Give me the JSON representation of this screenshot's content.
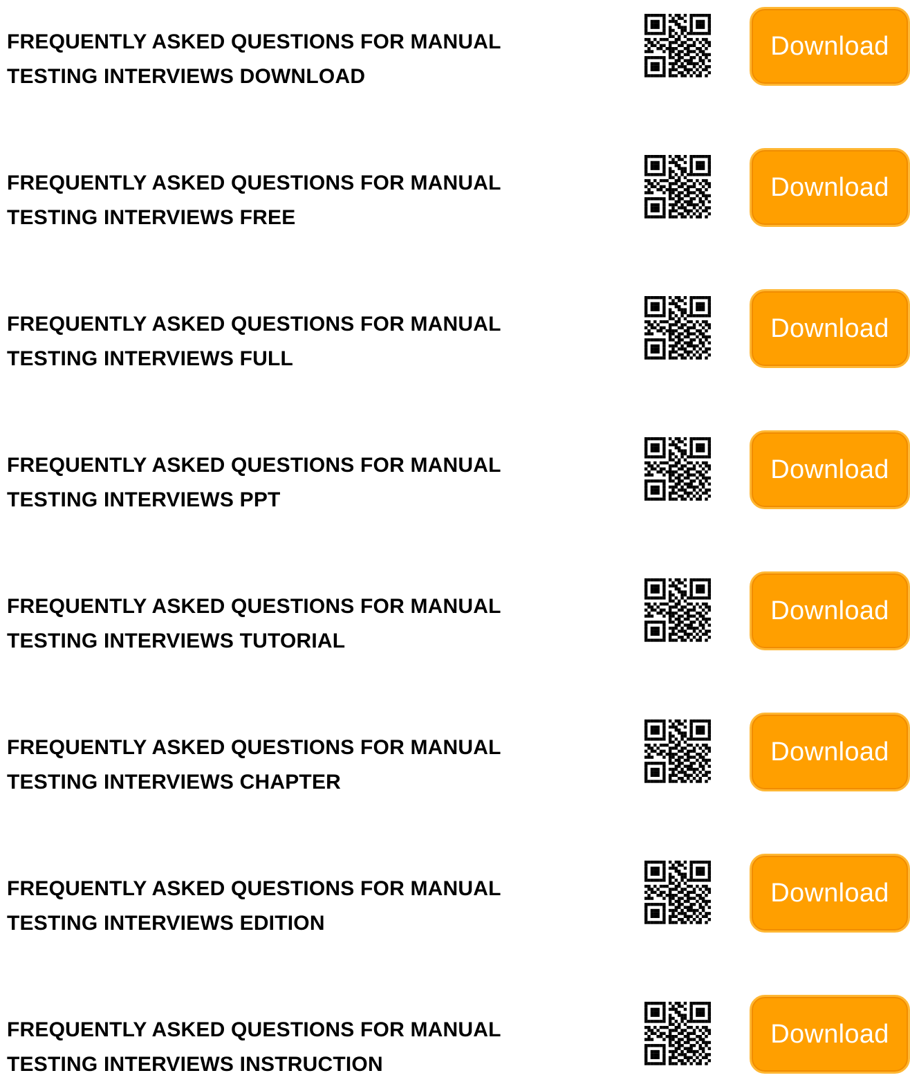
{
  "colors": {
    "button_bg": "#ff9f00",
    "button_border": "#ffb733",
    "button_text": "#ffffff",
    "title_text": "#000000"
  },
  "items": [
    {
      "title_line1": "FREQUENTLY ASKED QUESTIONS FOR MANUAL",
      "title_line2": "TESTING INTERVIEWS DOWNLOAD",
      "qr_icon": "qr-code-icon",
      "button_label": "Download"
    },
    {
      "title_line1": "FREQUENTLY ASKED QUESTIONS FOR MANUAL",
      "title_line2": "TESTING INTERVIEWS FREE",
      "qr_icon": "qr-code-icon",
      "button_label": "Download"
    },
    {
      "title_line1": "FREQUENTLY ASKED QUESTIONS FOR MANUAL",
      "title_line2": "TESTING INTERVIEWS FULL",
      "qr_icon": "qr-code-icon",
      "button_label": "Download"
    },
    {
      "title_line1": "FREQUENTLY ASKED QUESTIONS FOR MANUAL",
      "title_line2": "TESTING INTERVIEWS PPT",
      "qr_icon": "qr-code-icon",
      "button_label": "Download"
    },
    {
      "title_line1": "FREQUENTLY ASKED QUESTIONS FOR MANUAL",
      "title_line2": "TESTING INTERVIEWS TUTORIAL",
      "qr_icon": "qr-code-icon",
      "button_label": "Download"
    },
    {
      "title_line1": "FREQUENTLY ASKED QUESTIONS FOR MANUAL",
      "title_line2": "TESTING INTERVIEWS CHAPTER",
      "qr_icon": "qr-code-icon",
      "button_label": "Download"
    },
    {
      "title_line1": "FREQUENTLY ASKED QUESTIONS FOR MANUAL",
      "title_line2": "TESTING INTERVIEWS EDITION",
      "qr_icon": "qr-code-icon",
      "button_label": "Download"
    },
    {
      "title_line1": "FREQUENTLY ASKED QUESTIONS FOR MANUAL",
      "title_line2": "TESTING INTERVIEWS INSTRUCTION",
      "qr_icon": "qr-code-icon",
      "button_label": "Download"
    }
  ]
}
